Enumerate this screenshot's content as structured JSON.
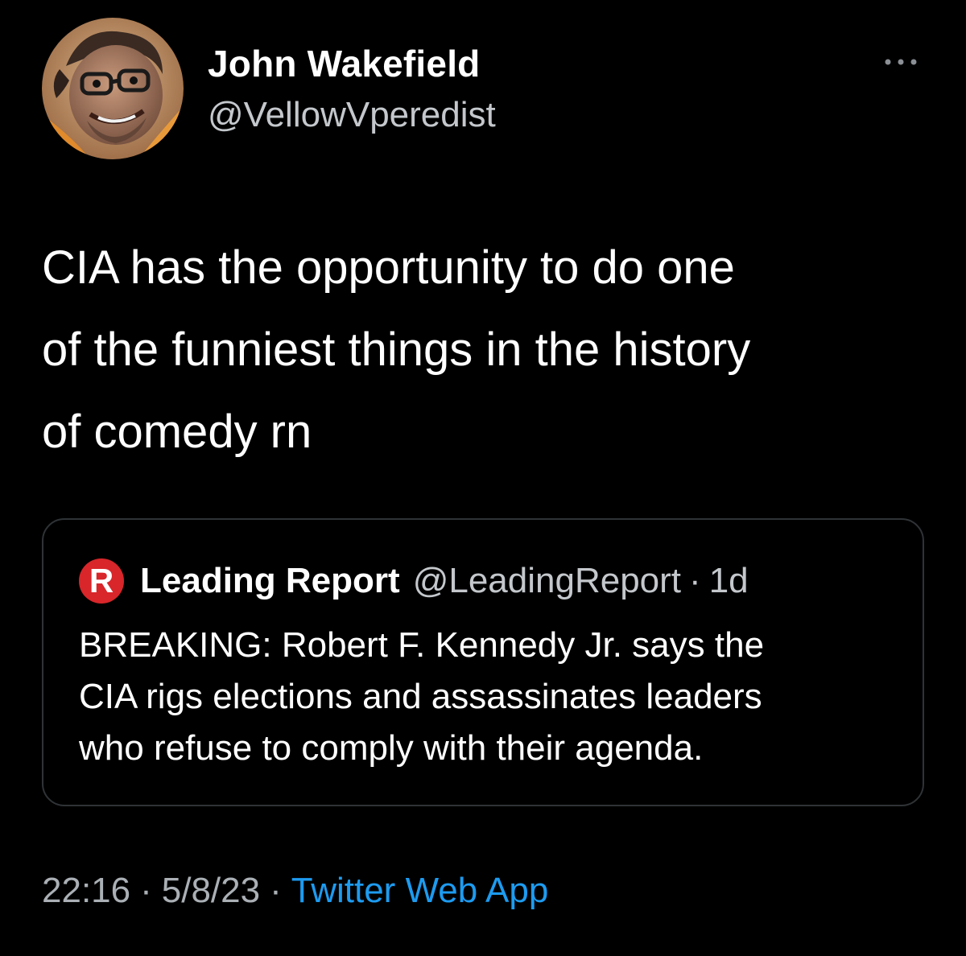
{
  "author": {
    "display_name": "John Wakefield",
    "handle": "@VellowVperedist"
  },
  "tweet": {
    "text_lines": [
      "CIA has the opportunity to do one",
      "of the funniest things in the history",
      "of comedy rn"
    ]
  },
  "quoted_tweet": {
    "logo_letter": "R",
    "display_name": "Leading Report",
    "handle": "@LeadingReport",
    "separator": "·",
    "age": "1d",
    "text_lines": [
      "BREAKING: Robert F. Kennedy Jr. says the",
      "CIA rigs elections and assassinates leaders",
      "who refuse to comply with their agenda."
    ]
  },
  "meta": {
    "time": "22:16",
    "date": "5/8/23",
    "separator": "·",
    "source": "Twitter Web App"
  },
  "icons": {
    "more": "more-horizontal-icon",
    "quote_logo": "leading-report-logo"
  },
  "colors": {
    "background": "#000000",
    "link": "#1d9bf0",
    "secondary_text": "#aab0b5",
    "quote_border": "#2f3336",
    "logo_red": "#d8262a"
  }
}
